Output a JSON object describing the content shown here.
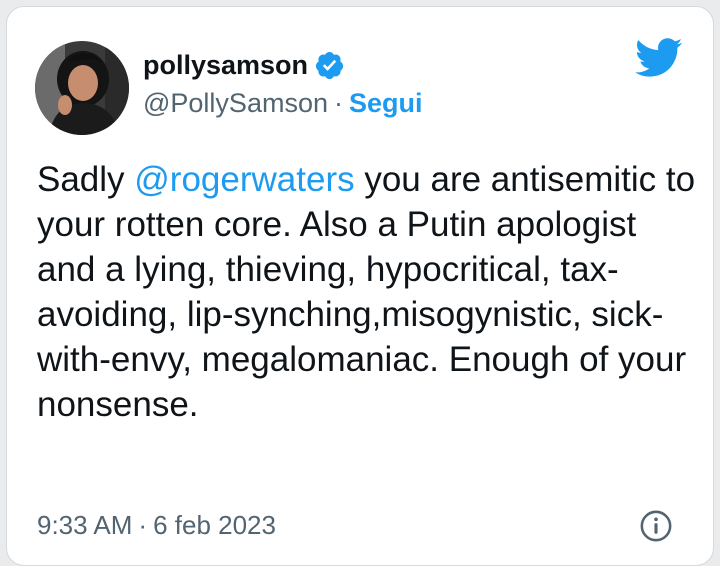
{
  "user": {
    "display_name": "pollysamson",
    "handle": "@PollySamson",
    "separator": "·",
    "follow_label": "Segui",
    "verified": true,
    "avatar_icon": "profile-photo"
  },
  "tweet": {
    "text_before_mention": "Sadly ",
    "mention": "@rogerwaters",
    "text_after_mention": " you are antisemitic to your rotten core. Also a Putin apologist and a lying, thieving, hypocritical, tax-avoiding, lip-synching,misogynistic, sick-with-envy, megalomaniac. Enough of your nonsense."
  },
  "footer": {
    "time": "9:33 AM",
    "separator": "·",
    "date": "6 feb 2023",
    "info_icon": "info-icon"
  },
  "icons": {
    "brand": "twitter-bird-icon",
    "verified": "verified-badge-icon"
  },
  "colors": {
    "accent": "#1d9bf0",
    "text": "#0f1419",
    "muted": "#536471"
  }
}
